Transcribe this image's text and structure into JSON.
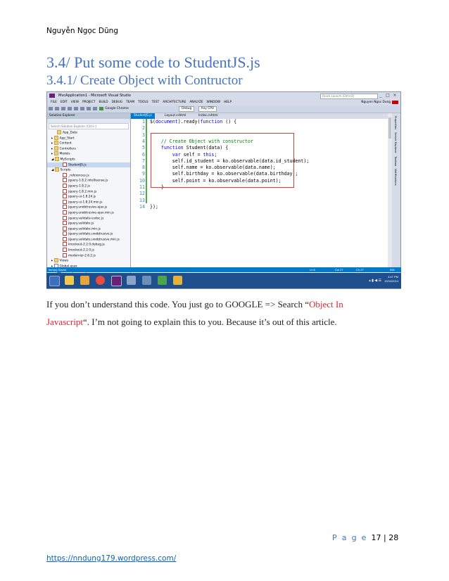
{
  "header": {
    "author": "Nguyễn Ngọc Dũng"
  },
  "headings": {
    "h1": "3.4/ Put some code to StudentJS.js",
    "h2": "3.4.1/ Create Object with Contructor"
  },
  "screenshot": {
    "window_title": "MvcApplication1 - Microsoft Visual Studio",
    "quick_launch": "Quick Launch (Ctrl+Q)",
    "menu": [
      "FILE",
      "EDIT",
      "VIEW",
      "PROJECT",
      "BUILD",
      "DEBUG",
      "TEAM",
      "TOOLS",
      "TEST",
      "ARCHITECTURE",
      "ANALYZE",
      "WINDOW",
      "HELP"
    ],
    "user_name": "Nguyen Ngoc Dung",
    "toolbar": {
      "browser": "Google Chrome",
      "config": "Debug",
      "platform": "Any CPU"
    },
    "solution_explorer": {
      "title": "Solution Explorer",
      "search_placeholder": "Search Solution Explorer (Ctrl+;)",
      "items": [
        "App_Data",
        "App_Start",
        "Content",
        "Controllers",
        "Models",
        "MyScripts",
        "StudentJS.js",
        "Scripts",
        "_references.js",
        "jquery-1.8.2.intellisense.js",
        "jquery-1.8.2.js",
        "jquery-1.8.2.min.js",
        "jquery-ui-1.8.24.js",
        "jquery-ui-1.8.24.min.js",
        "jquery.unobtrusive-ajax.js",
        "jquery.unobtrusive-ajax.min.js",
        "jquery.validate-vsdoc.js",
        "jquery.validate.js",
        "jquery.validate.min.js",
        "jquery.validate.unobtrusive.js",
        "jquery.validate.unobtrusive.min.js",
        "knockout-2.2.0.debug.js",
        "knockout-2.2.0.js",
        "modernizr-2.6.2.js",
        "Views",
        "Global.asax",
        "packages.config"
      ],
      "tabs": [
        "Solution Ex...",
        "Class View",
        "Property...",
        "Team Expl..."
      ]
    },
    "tabs": [
      "StudentJS.js",
      "Layout.cshtml",
      "Index.cshtml"
    ],
    "right_bar": [
      "Properties",
      "Server Explorer",
      "Toolbox",
      "Notifications"
    ],
    "code_lines": [
      {
        "n": "1",
        "text": "$(document).ready(function () {"
      },
      {
        "n": "2",
        "text": ""
      },
      {
        "n": "3",
        "text": ""
      },
      {
        "n": "4",
        "text": "    // Create Object with constructor"
      },
      {
        "n": "5",
        "text": "    function Student(data) {"
      },
      {
        "n": "6",
        "text": "        var self = this;"
      },
      {
        "n": "7",
        "text": "        self.id_student = ko.observable(data.id_student);"
      },
      {
        "n": "8",
        "text": "        self.name = ko.observable(data.name);"
      },
      {
        "n": "9",
        "text": "        self.birthday = ko.observable(data.birthday);"
      },
      {
        "n": "10",
        "text": "        self.point = ko.observable(data.point);"
      },
      {
        "n": "11",
        "text": "    }"
      },
      {
        "n": "12",
        "text": ""
      },
      {
        "n": "13",
        "text": ""
      },
      {
        "n": "14",
        "text": "});"
      }
    ],
    "zoom": "100 %",
    "output_tabs": [
      "Output",
      "Error List"
    ],
    "status": {
      "saved": "Item(s) Saved",
      "ln": "Ln 6",
      "col": "Col 27",
      "ch": "Ch 27",
      "ins": "INS"
    },
    "clock": {
      "time": "4:47 PM",
      "date": "12/04/2014"
    }
  },
  "body": {
    "p1_a": "If you don’t understand this code. You just go to GOOGLE => Search “",
    "p1_red": "Object In Javascript",
    "p1_b": "“. I’m not going to explain this to you. Because it’s out of this article."
  },
  "footer": {
    "page_word": "P a g e",
    "page_num": "17 | 28",
    "url": "https://nndung179.wordpress.com/"
  },
  "colors": {
    "heading": "#4472c4",
    "link": "#0563c1",
    "highlight": "#e0222f",
    "vs_blue": "#007acc"
  }
}
